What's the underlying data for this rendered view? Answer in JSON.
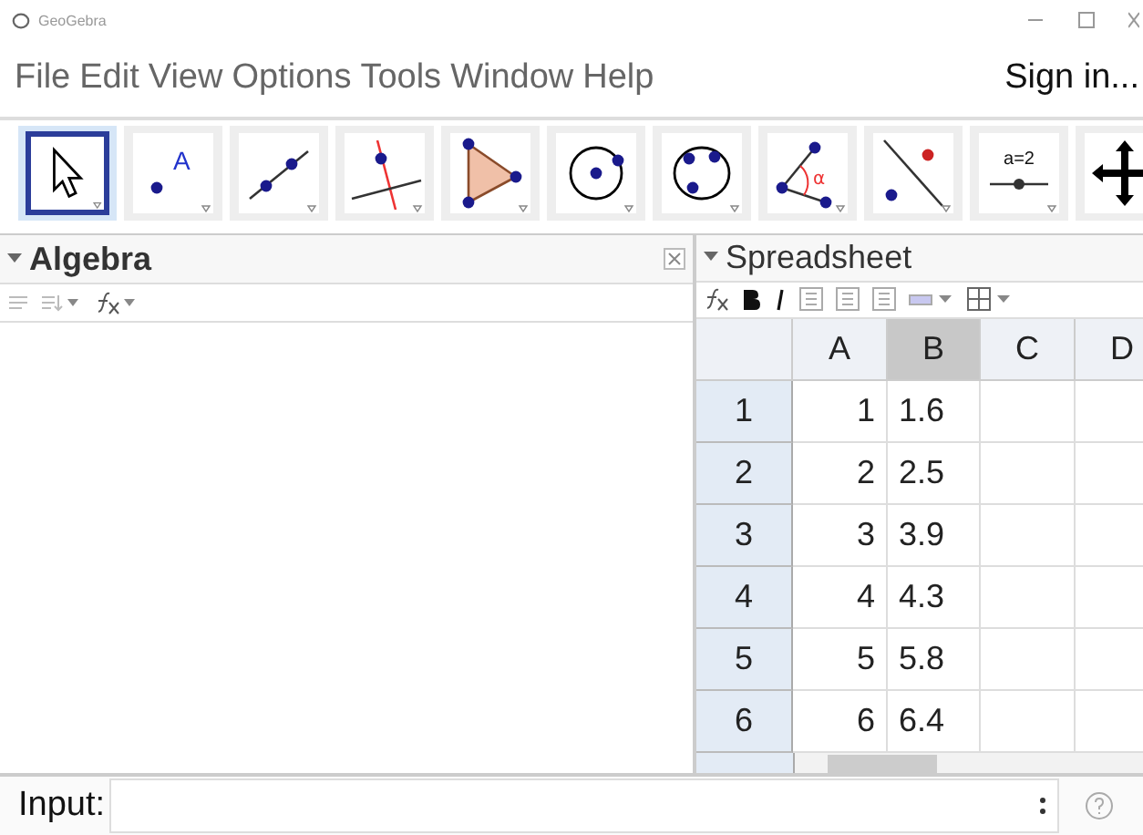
{
  "window": {
    "title": "GeoGebra"
  },
  "menu": [
    "File",
    "Edit",
    "View",
    "Options",
    "Tools",
    "Window",
    "Help"
  ],
  "sign_in": "Sign in...",
  "tools": [
    {
      "kind": "move",
      "selected": true
    },
    {
      "kind": "point",
      "selected": false,
      "label": "A"
    },
    {
      "kind": "line",
      "selected": false
    },
    {
      "kind": "perpendicular",
      "selected": false
    },
    {
      "kind": "polygon",
      "selected": false
    },
    {
      "kind": "circle",
      "selected": false
    },
    {
      "kind": "conic",
      "selected": false
    },
    {
      "kind": "angle",
      "selected": false,
      "label": "α"
    },
    {
      "kind": "reflect",
      "selected": false
    },
    {
      "kind": "slider",
      "selected": false,
      "label": "a=2"
    },
    {
      "kind": "pan",
      "selected": false
    }
  ],
  "algebra": {
    "title": "Algebra"
  },
  "spreadsheet": {
    "title": "Spreadsheet",
    "columns": [
      {
        "label": "A",
        "selected": false
      },
      {
        "label": "B",
        "selected": true
      },
      {
        "label": "C",
        "selected": false
      },
      {
        "label": "D",
        "selected": false
      }
    ],
    "rows": [
      {
        "header": "1",
        "cells": [
          "1",
          "1.6"
        ]
      },
      {
        "header": "2",
        "cells": [
          "2",
          "2.5"
        ]
      },
      {
        "header": "3",
        "cells": [
          "3",
          "3.9"
        ]
      },
      {
        "header": "4",
        "cells": [
          "4",
          "4.3"
        ]
      },
      {
        "header": "5",
        "cells": [
          "5",
          "5.8"
        ]
      },
      {
        "header": "6",
        "cells": [
          "6",
          "6.4"
        ]
      }
    ]
  },
  "input": {
    "label": "Input:"
  }
}
